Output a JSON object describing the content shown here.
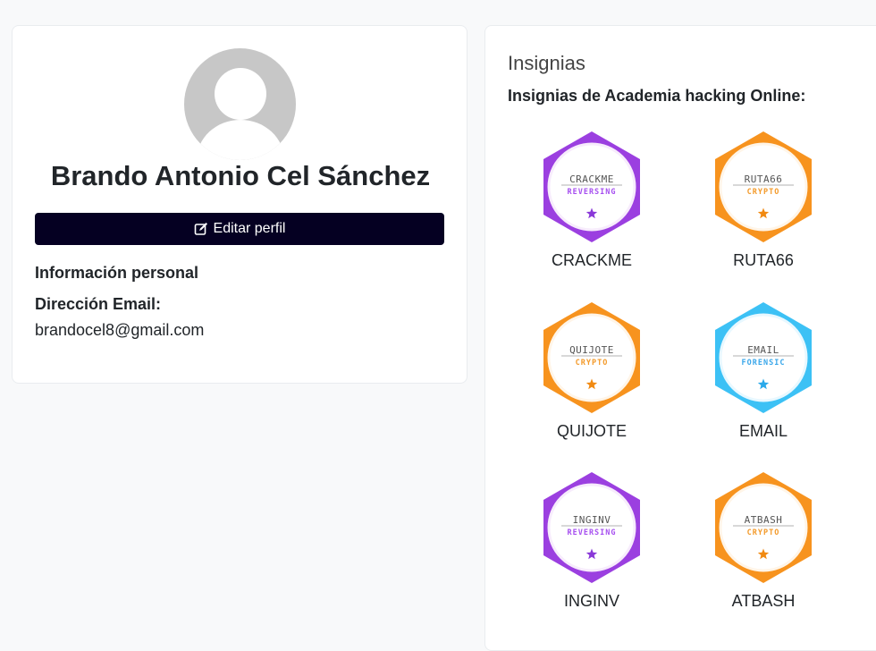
{
  "profile": {
    "name": "Brando Antonio Cel Sánchez",
    "edit_button": "Editar perfil",
    "section_title": "Información personal",
    "email_label": "Dirección Email:",
    "email_value": "brandocel8@gmail.com"
  },
  "badges_panel": {
    "title": "Insignias",
    "subtitle": "Insignias de Academia hacking Online:",
    "badges": [
      {
        "name": "CRACKME",
        "logo": "CRACKME",
        "category": "REVERSING",
        "color": "#9b3fe0",
        "ring": "#f7ecfc",
        "star": "#8a39d8",
        "cat_color": "#a64ff0"
      },
      {
        "name": "RUTA66",
        "logo": "RUTA66",
        "category": "CRYPTO",
        "color": "#f7931e",
        "ring": "#fff5e8",
        "star": "#f18a12",
        "cat_color": "#f39a2a"
      },
      {
        "name": "QUIJOTE",
        "logo": "QUIJOTE",
        "category": "CRYPTO",
        "color": "#f7931e",
        "ring": "#fff5e8",
        "star": "#f18a12",
        "cat_color": "#f39a2a"
      },
      {
        "name": "EMAIL",
        "logo": "EMAIL",
        "category": "FORENSIC",
        "color": "#3cc1f5",
        "ring": "#e8f8ff",
        "star": "#2aa9ea",
        "cat_color": "#3aa7ea"
      },
      {
        "name": "INGINV",
        "logo": "INGINV",
        "category": "REVERSING",
        "color": "#9b3fe0",
        "ring": "#f7ecfc",
        "star": "#8a39d8",
        "cat_color": "#a64ff0"
      },
      {
        "name": "ATBASH",
        "logo": "ATBASH",
        "category": "CRYPTO",
        "color": "#f7931e",
        "ring": "#fff5e8",
        "star": "#f18a12",
        "cat_color": "#f39a2a"
      }
    ]
  },
  "icons": {
    "avatar": "user-avatar-icon",
    "edit": "edit-icon",
    "star": "star-icon"
  }
}
